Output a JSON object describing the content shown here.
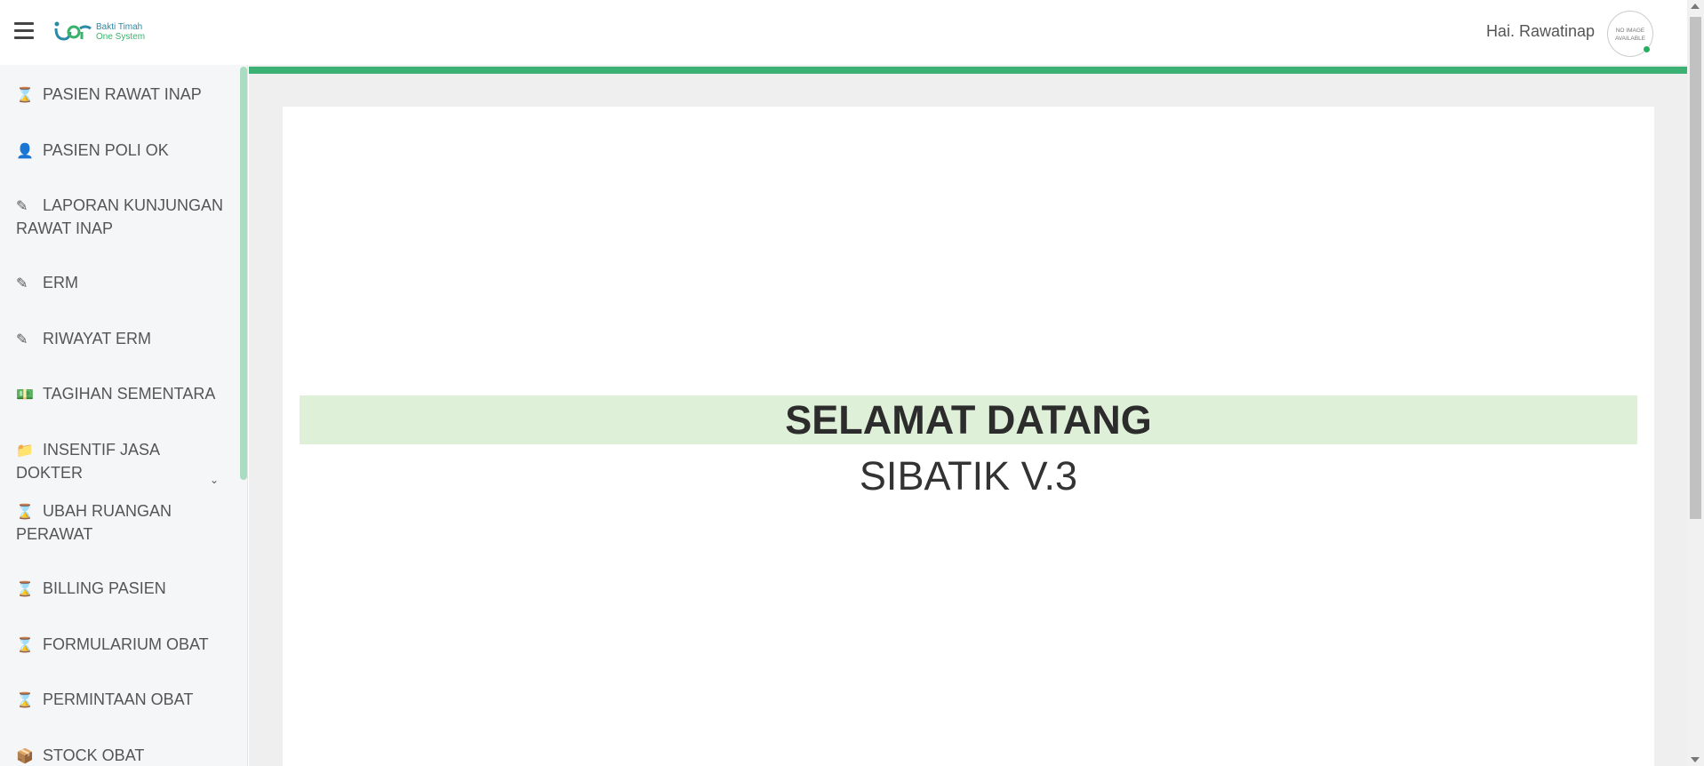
{
  "header": {
    "logo": {
      "line1": "Bakti Timah",
      "line2": "One System"
    },
    "greeting": "Hai. Rawatinap",
    "avatar_text": "NO IMAGE AVAILABLE"
  },
  "sidebar": {
    "items": [
      {
        "label": "PASIEN RAWAT INAP",
        "icon": "hourglass-icon"
      },
      {
        "label": "PASIEN POLI OK",
        "icon": "user-icon"
      },
      {
        "label": "LAPORAN KUNJUNGAN RAWAT INAP",
        "icon": "edit-icon"
      },
      {
        "label": "ERM",
        "icon": "edit-icon"
      },
      {
        "label": "RIWAYAT ERM",
        "icon": "edit-icon"
      },
      {
        "label": "TAGIHAN SEMENTARA",
        "icon": "money-icon"
      },
      {
        "label": "INSENTIF JASA DOKTER",
        "icon": "folder-icon"
      },
      {
        "label": "UBAH RUANGAN PERAWAT",
        "icon": "hourglass-icon"
      },
      {
        "label": "BILLING PASIEN",
        "icon": "hourglass-icon"
      },
      {
        "label": "FORMULARIUM OBAT",
        "icon": "hourglass-icon"
      },
      {
        "label": "PERMINTAAN OBAT",
        "icon": "hourglass-icon"
      },
      {
        "label": "STOCK OBAT",
        "icon": "box-icon"
      }
    ]
  },
  "main": {
    "welcome_title": "SELAMAT DATANG",
    "app_name": "SIBATIK V.3"
  },
  "colors": {
    "accent_green": "#3bb174",
    "welcome_bg": "#dff0d8",
    "sidebar_bg": "#f5f6f8"
  }
}
